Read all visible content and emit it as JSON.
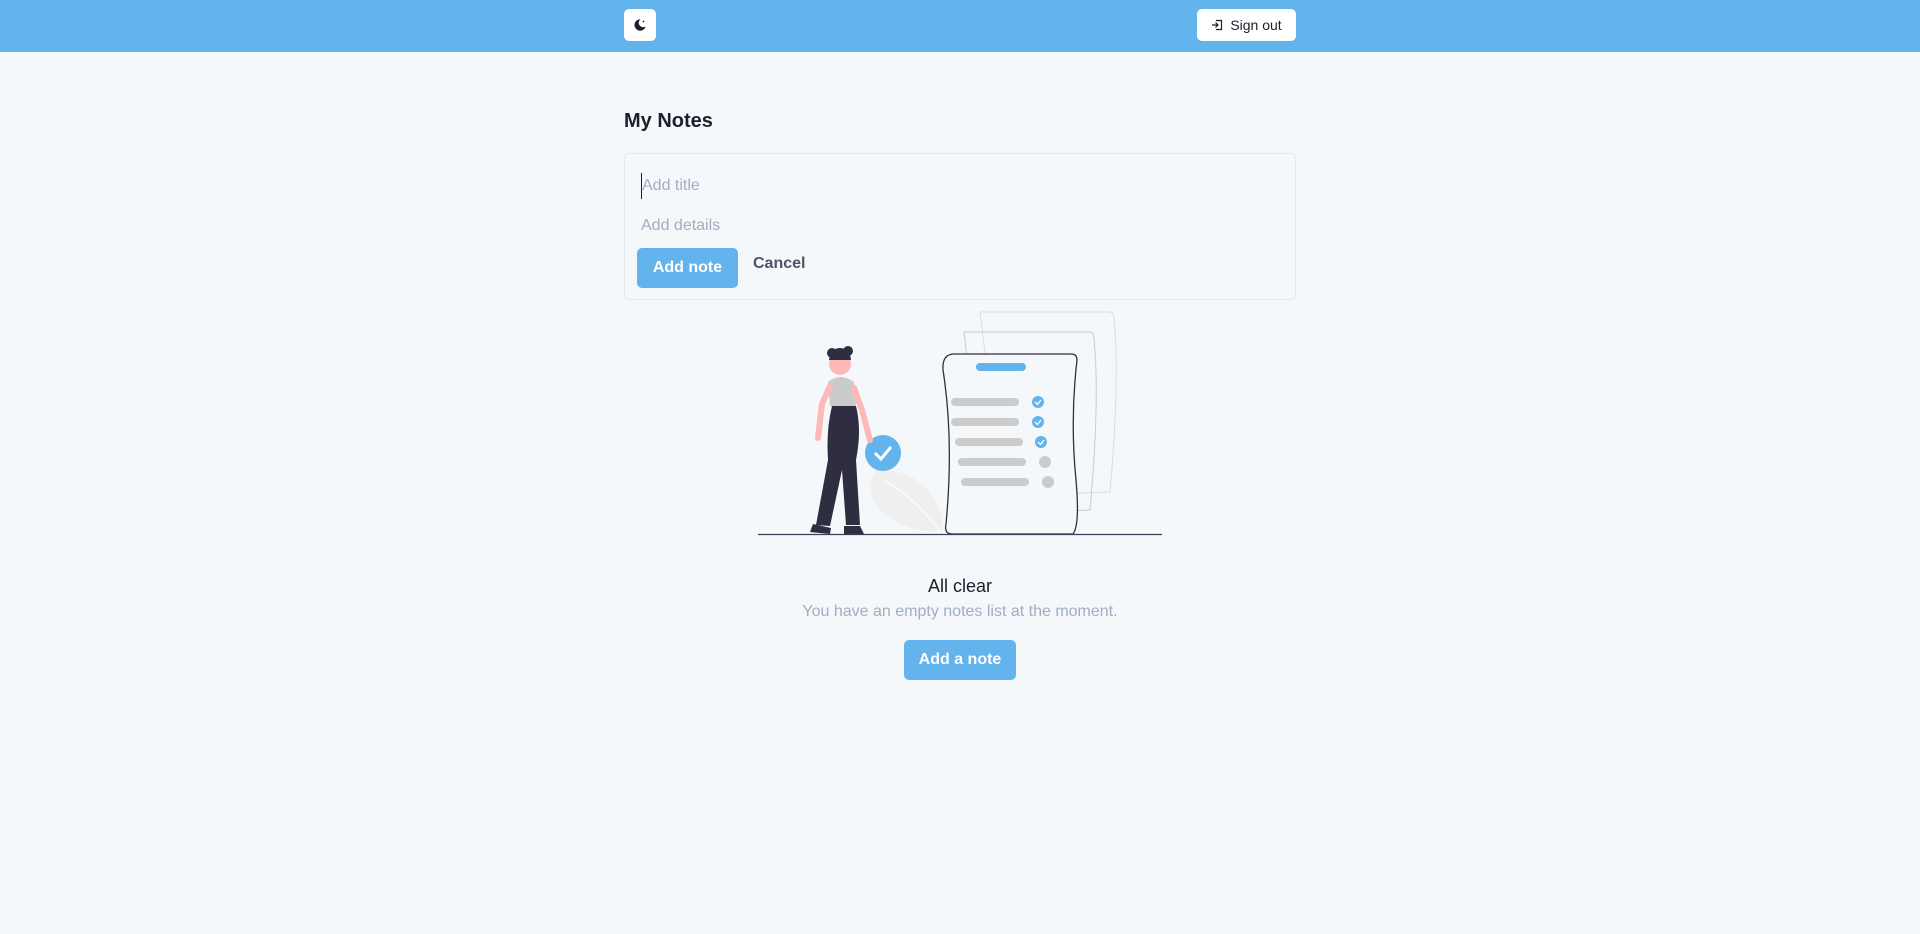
{
  "header": {
    "theme_toggle_icon": "moon-icon",
    "signout_icon": "sign-out-icon",
    "signout_label": "Sign out",
    "background_color": "#63b3ed"
  },
  "main": {
    "title": "My Notes",
    "form": {
      "title_placeholder": "Add title",
      "title_value": "",
      "details_placeholder": "Add details",
      "details_value": "",
      "add_button_label": "Add note",
      "cancel_label": "Cancel"
    },
    "empty_state": {
      "illustration": "empty-notes-illustration",
      "title": "All clear",
      "subtitle": "You have an empty notes list at the moment.",
      "button_label": "Add a note"
    }
  },
  "colors": {
    "accent": "#63b3ed",
    "background": "#f5f8fb",
    "muted_text": "#a0aec0"
  }
}
